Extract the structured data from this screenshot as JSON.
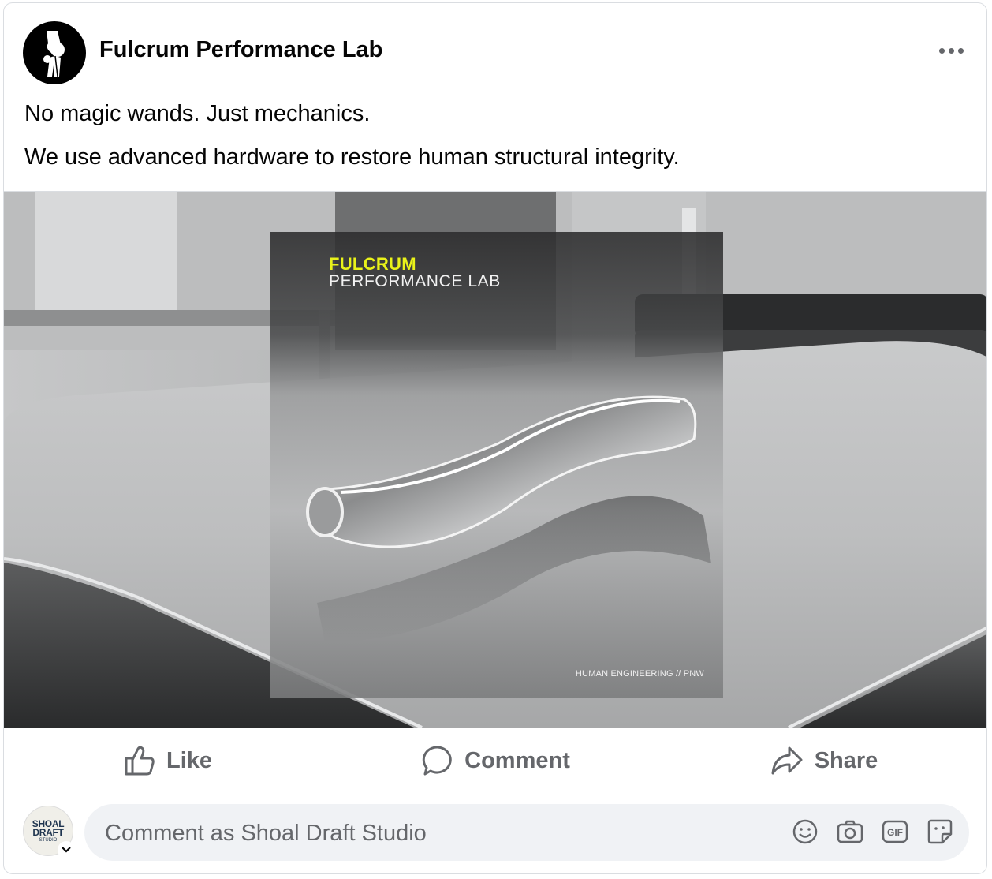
{
  "post": {
    "author": "Fulcrum Performance Lab",
    "text_lines": [
      "No magic wands. Just mechanics.",
      "We use advanced hardware to restore human structural integrity."
    ],
    "image": {
      "brand_top": "FULCRUM",
      "brand_bottom": "PERFORMANCE LAB",
      "tagline": "HUMAN ENGINEERING // PNW"
    }
  },
  "actions": {
    "like": "Like",
    "comment": "Comment",
    "share": "Share"
  },
  "composer": {
    "placeholder": "Comment as Shoal Draft Studio",
    "avatar_line1": "SHOAL",
    "avatar_line2": "DRAFT",
    "avatar_line3": "STUDIO",
    "icons": [
      "emoji-icon",
      "camera-icon",
      "gif-icon",
      "sticker-icon"
    ]
  },
  "colors": {
    "accent_yellow": "#e9f21a",
    "secondary_text": "#65676b",
    "input_bg": "#f0f2f5"
  }
}
